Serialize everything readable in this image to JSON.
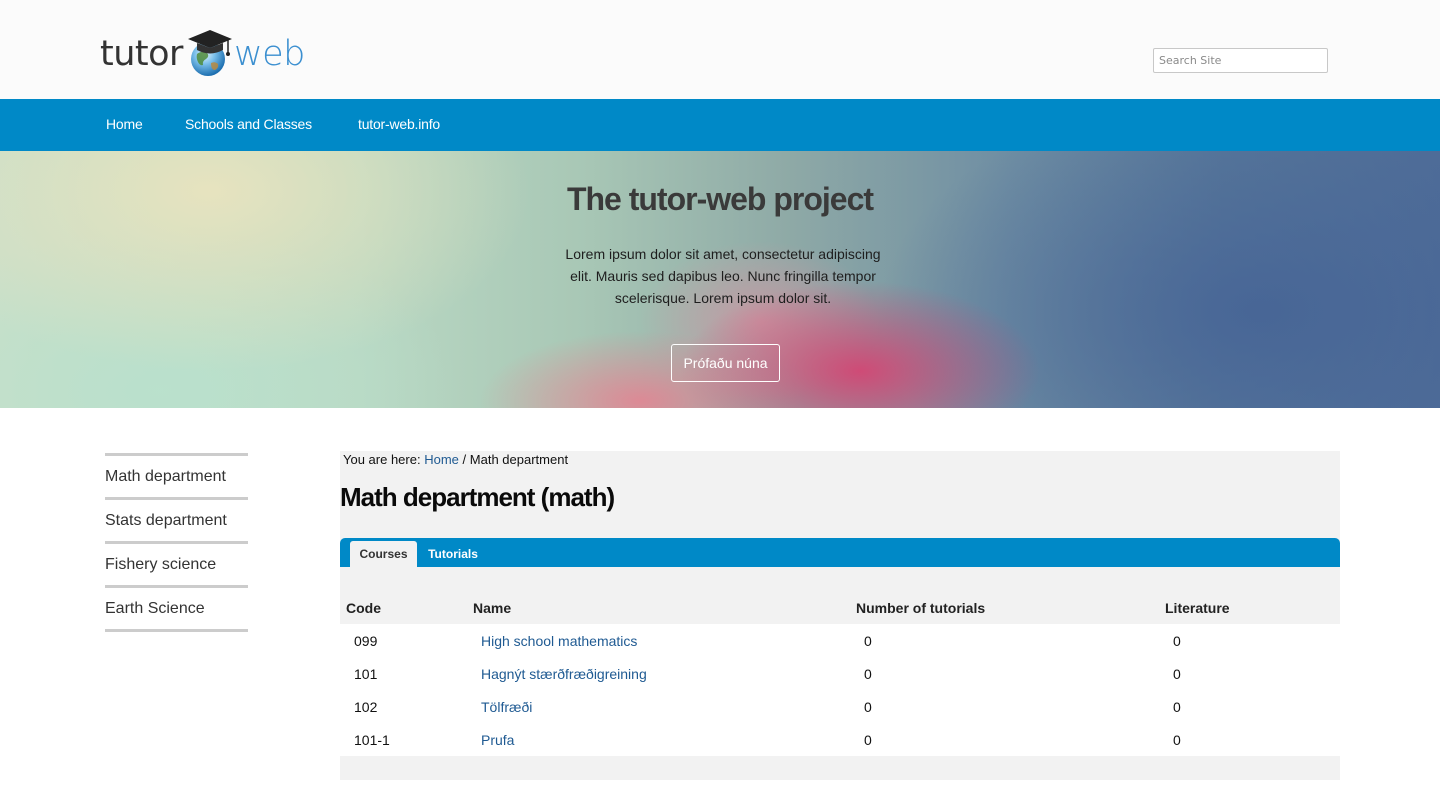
{
  "header": {
    "logo": {
      "word1": "tutor",
      "word2": "web"
    },
    "search": {
      "placeholder": "Search Site"
    }
  },
  "nav": {
    "items": [
      "Home",
      "Schools and Classes",
      "tutor-web.info"
    ]
  },
  "hero": {
    "title": "The tutor-web project",
    "text": "Lorem ipsum dolor sit amet, consectetur adipiscing elit. Mauris sed dapibus leo. Nunc fringilla tempor scelerisque. Lorem ipsum dolor sit.",
    "button": "Prófaðu núna"
  },
  "sidebar": {
    "items": [
      "Math department",
      "Stats department",
      "Fishery science",
      "Earth Science"
    ]
  },
  "breadcrumb": {
    "prefix": "You are here:",
    "home": "Home",
    "separator": "/",
    "current": "Math department"
  },
  "page": {
    "title": "Math department (math)"
  },
  "tabs": [
    {
      "label": "Courses",
      "active": true
    },
    {
      "label": "Tutorials",
      "active": false
    }
  ],
  "table": {
    "headers": [
      "Code",
      "Name",
      "Number of tutorials",
      "Literature"
    ],
    "rows": [
      {
        "code": "099",
        "name": "High school mathematics",
        "tutorials": "0",
        "literature": "0"
      },
      {
        "code": "101",
        "name": "Hagnýt stærðfræðigreining",
        "tutorials": "0",
        "literature": "0"
      },
      {
        "code": "102",
        "name": "Tölfræði",
        "tutorials": "0",
        "literature": "0"
      },
      {
        "code": "101-1",
        "name": "Prufa",
        "tutorials": "0",
        "literature": "0"
      }
    ]
  },
  "colors": {
    "nav": "#0089c7",
    "link": "#1f5a92",
    "panel": "#f2f2f2"
  },
  "icons": {
    "logo": "graduation-cap-globe-icon"
  }
}
